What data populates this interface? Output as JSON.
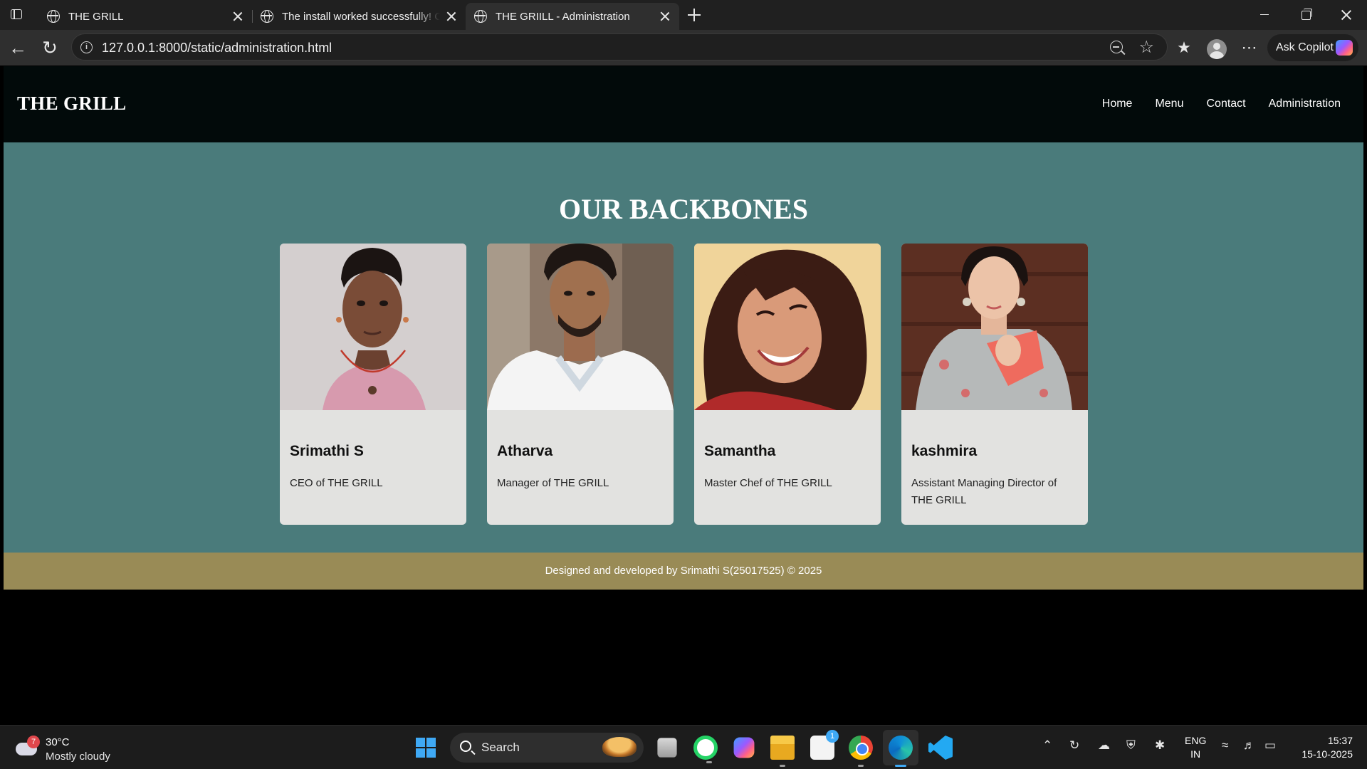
{
  "browser": {
    "tabs": [
      {
        "title": "THE GRILL",
        "active": false
      },
      {
        "title": "The install worked successfully! Congratulations!",
        "active": false
      },
      {
        "title": "THE GRIILL - Administration",
        "active": true
      }
    ],
    "url": "127.0.0.1:8000/static/administration.html",
    "copilot_label": "Ask Copilot"
  },
  "site": {
    "brand": "THE GRILL",
    "nav": [
      "Home",
      "Menu",
      "Contact",
      "Administration"
    ],
    "section_title": "OUR BACKBONES",
    "members": [
      {
        "name": "Srimathi S",
        "role": "CEO of THE GRILL"
      },
      {
        "name": "Atharva",
        "role": "Manager of THE GRILL"
      },
      {
        "name": "Samantha",
        "role": "Master Chef of THE GRILL"
      },
      {
        "name": "kashmira",
        "role": "Assistant Managing Director of THE GRILL"
      }
    ],
    "footer": "Designed and developed by Srimathi S(25017525) © 2025"
  },
  "taskbar": {
    "weather_badge": "7",
    "temperature": "30°C",
    "condition": "Mostly cloudy",
    "search_label": "Search",
    "store_badge": "1",
    "lang_line1": "ENG",
    "lang_line2": "IN",
    "time": "15:37",
    "date": "15-10-2025"
  },
  "colors": {
    "header_bg": "#020a0a",
    "section_bg": "#4a7b7b",
    "card_bg": "#e2e2e0",
    "footer_bg": "#998b56"
  }
}
